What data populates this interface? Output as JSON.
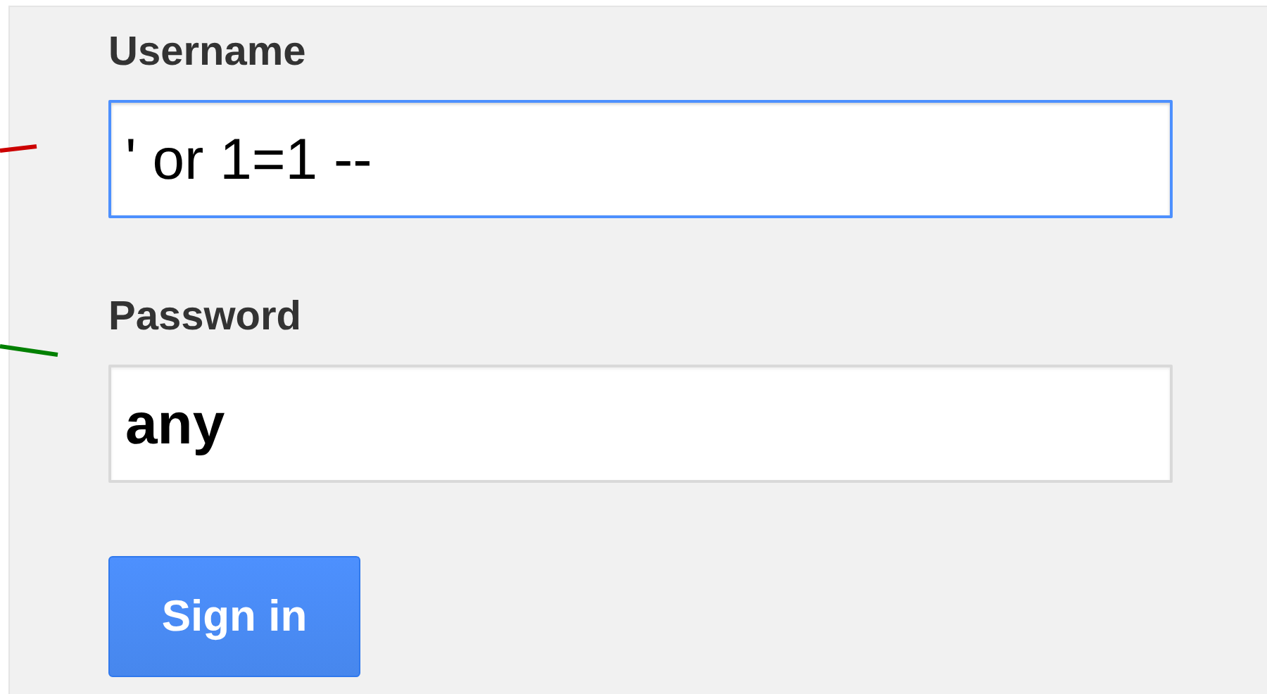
{
  "fields": [
    {
      "label": "Username",
      "value": "' or 1=1 --",
      "focused": true,
      "bold": false,
      "color": "#cc0000"
    },
    {
      "label": "Password",
      "value": "any",
      "focused": false,
      "bold": true,
      "color": "#008000"
    }
  ],
  "button": {
    "label": "Sign in"
  }
}
